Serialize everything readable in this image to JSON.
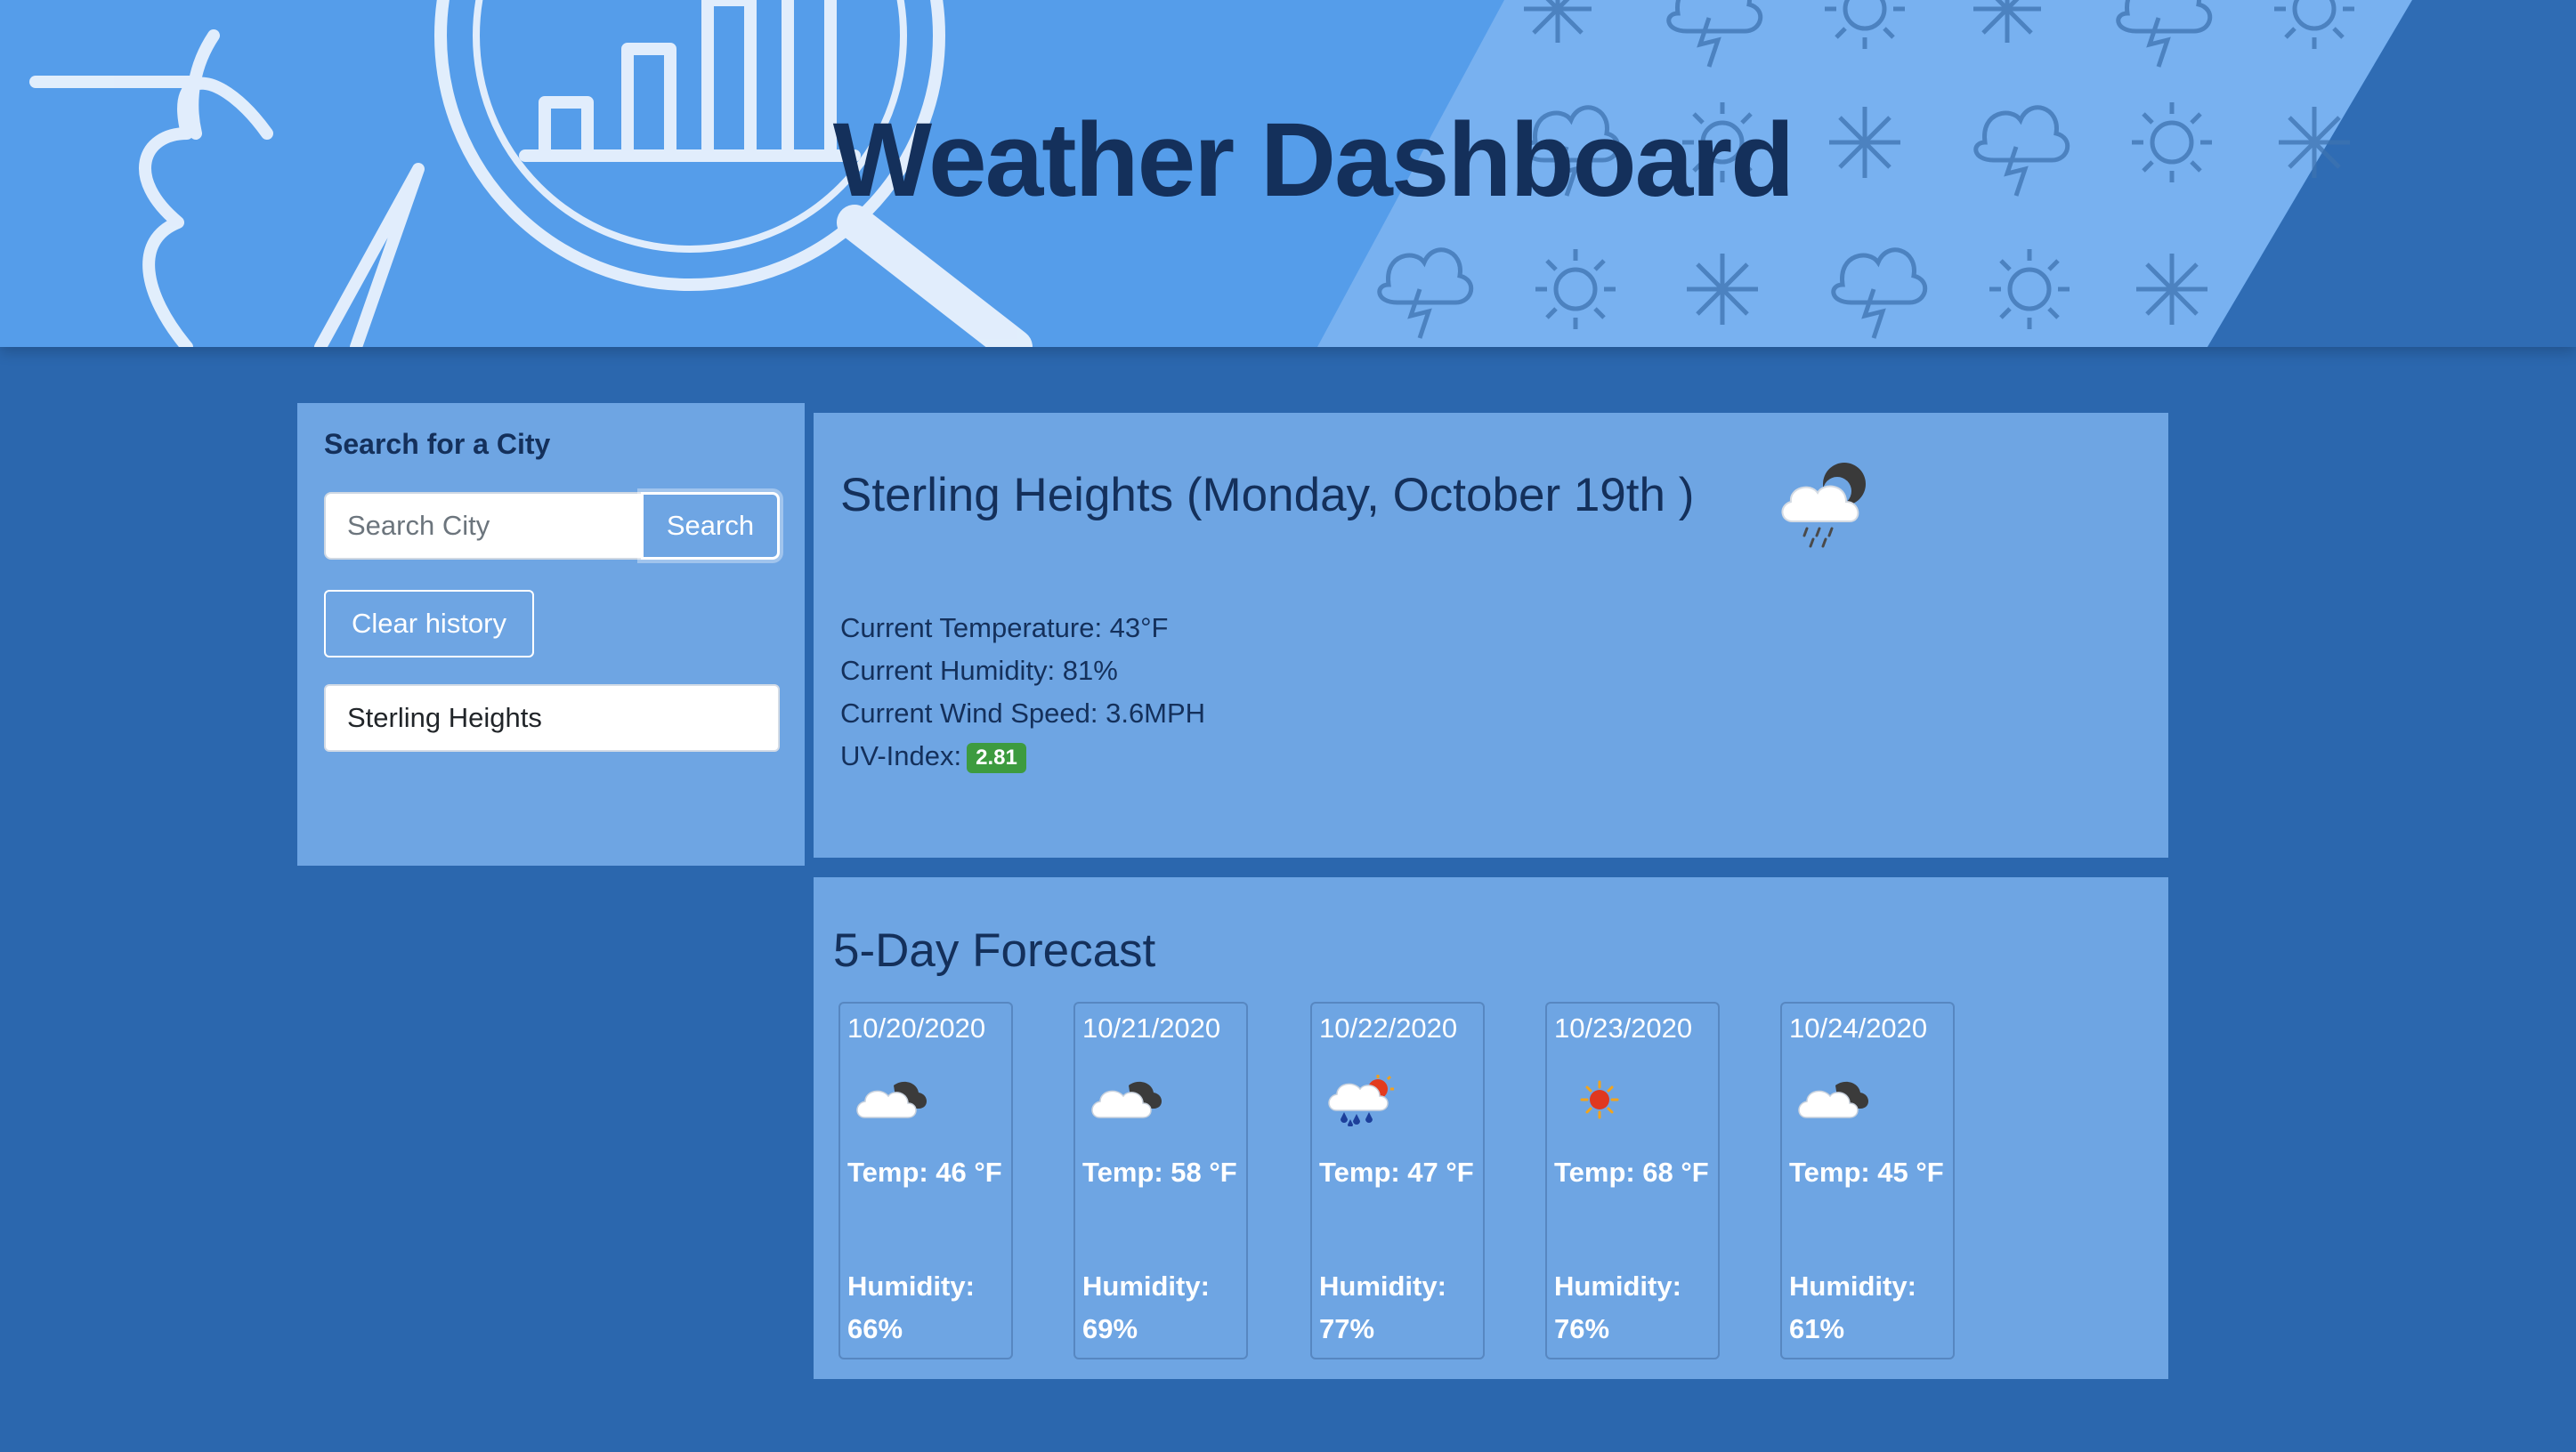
{
  "header": {
    "title": "Weather Dashboard"
  },
  "sidebar": {
    "label": "Search for a City",
    "search_placeholder": "Search City",
    "search_button": "Search",
    "clear_button": "Clear history",
    "history": [
      "Sterling Heights"
    ]
  },
  "current": {
    "city_date": "Sterling Heights (Monday, October 19th )",
    "icon": "rain-cloud-night-icon",
    "temperature": "Current Temperature: 43°F",
    "humidity": "Current Humidity: 81%",
    "wind": "Current Wind Speed: 3.6MPH",
    "uv_label": "UV-Index:",
    "uv_value": "2.81",
    "uv_color": "#3d9b3f"
  },
  "forecast": {
    "title": "5-Day Forecast",
    "days": [
      {
        "date": "10/20/2020",
        "icon": "cloudy-icon",
        "temp": "Temp: 46 °F",
        "humidity": "Humidity: 66%"
      },
      {
        "date": "10/21/2020",
        "icon": "cloudy-icon",
        "temp": "Temp: 58 °F",
        "humidity": "Humidity: 69%"
      },
      {
        "date": "10/22/2020",
        "icon": "rain-sun-icon",
        "temp": "Temp: 47 °F",
        "humidity": "Humidity: 77%"
      },
      {
        "date": "10/23/2020",
        "icon": "sun-icon",
        "temp": "Temp: 68 °F",
        "humidity": "Humidity: 76%"
      },
      {
        "date": "10/24/2020",
        "icon": "cloudy-icon",
        "temp": "Temp: 45 °F",
        "humidity": "Humidity: 61%"
      }
    ]
  },
  "colors": {
    "page_bg": "#2b67ae",
    "banner_bg": "#559dea",
    "card_bg": "#6ea5e3",
    "title_text": "#14305b"
  }
}
